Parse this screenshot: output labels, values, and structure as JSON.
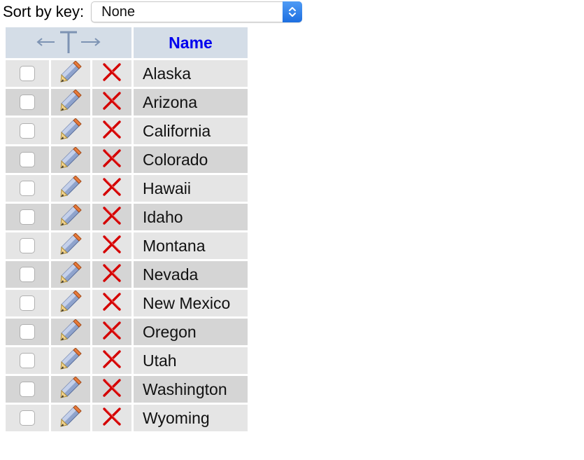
{
  "sort": {
    "label": "Sort by key:",
    "selected": "None"
  },
  "table": {
    "name_header": "Name",
    "rows": [
      "Alaska",
      "Arizona",
      "California",
      "Colorado",
      "Hawaii",
      "Idaho",
      "Montana",
      "Nevada",
      "New Mexico",
      "Oregon",
      "Utah",
      "Washington",
      "Wyoming"
    ]
  },
  "colors": {
    "header_bg": "#d4dde7",
    "row_odd_bg": "#e5e5e5",
    "row_even_bg": "#d5d5d5",
    "link_blue": "#0000ee",
    "delete_red": "#d40000",
    "select_accent": "#1d6fe0"
  },
  "icons": {
    "header": "column-arrows-icon",
    "edit": "pencil-icon",
    "delete": "delete-x-icon",
    "select": "updown-chevron-icon"
  }
}
